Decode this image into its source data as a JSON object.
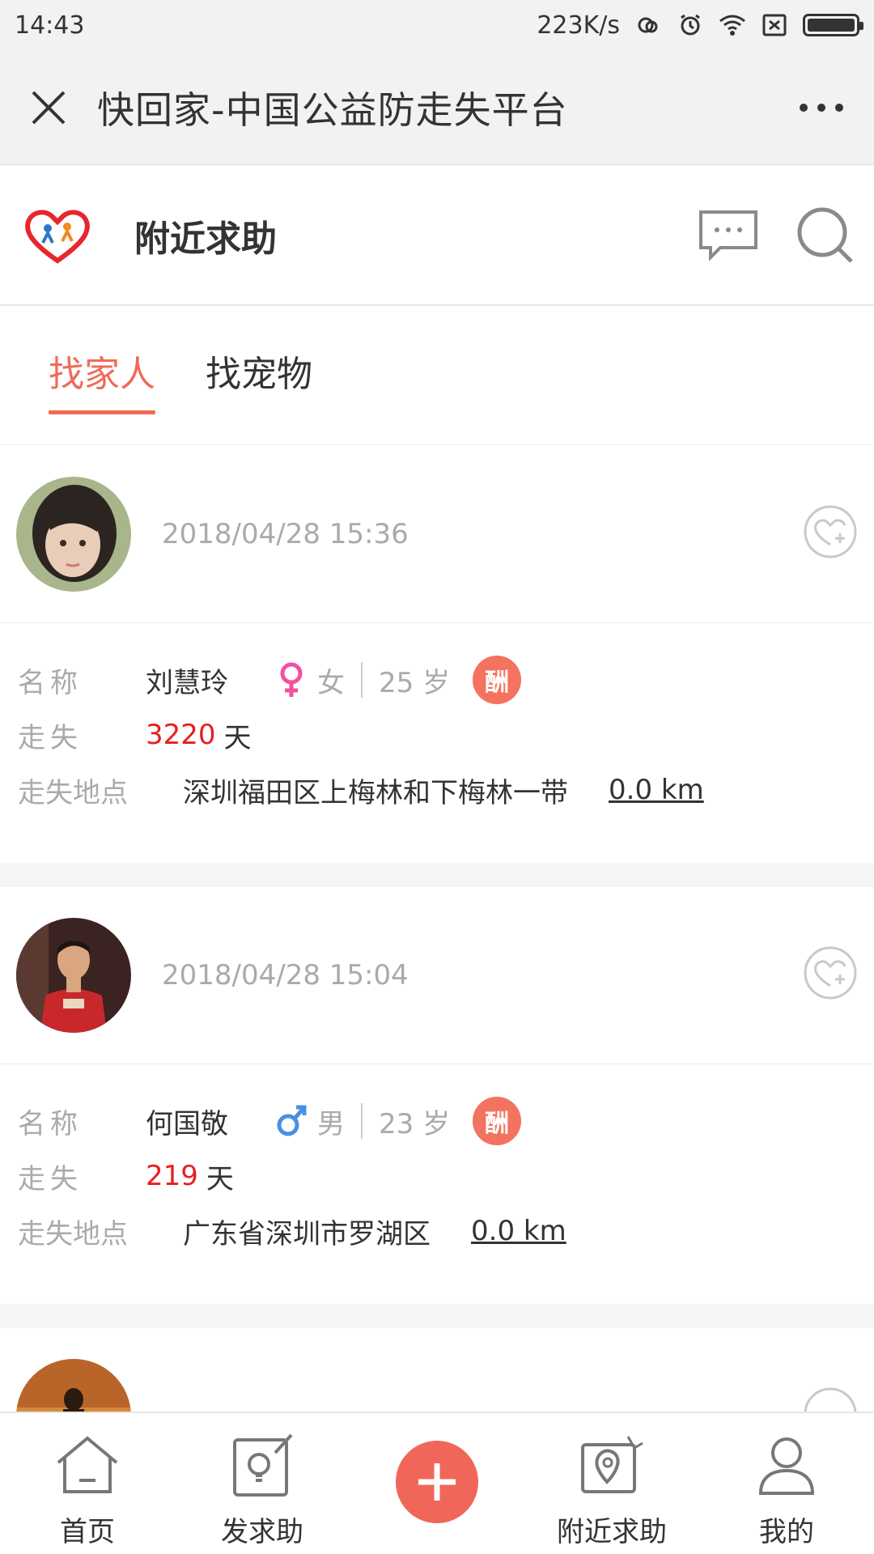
{
  "status_bar": {
    "time": "14:43",
    "speed": "223K/s"
  },
  "title_bar": {
    "title": "快回家-中国公益防走失平台"
  },
  "header": {
    "title": "附近求助"
  },
  "tabs": [
    {
      "label": "找家人",
      "active": true
    },
    {
      "label": "找宠物",
      "active": false
    }
  ],
  "cards": [
    {
      "date": "2018/04/28 15:36",
      "name_label": "名称",
      "name": "刘慧玲",
      "gender": "女",
      "age": "25 岁",
      "reward_badge": "酬",
      "missing_label": "走失",
      "missing_days": "3220",
      "days_unit": "天",
      "place_label": "走失地点",
      "place": "深圳福田区上梅林和下梅林一带",
      "distance": "0.0 km"
    },
    {
      "date": "2018/04/28 15:04",
      "name_label": "名称",
      "name": "何国敬",
      "gender": "男",
      "age": "23 岁",
      "reward_badge": "酬",
      "missing_label": "走失",
      "missing_days": "219",
      "days_unit": "天",
      "place_label": "走失地点",
      "place": "广东省深圳市罗湖区",
      "distance": "0.0 km"
    }
  ],
  "bottom_nav": [
    {
      "label": "首页",
      "icon": "home-icon"
    },
    {
      "label": "发求助",
      "icon": "post-help-icon"
    },
    {
      "label": "",
      "icon": "plus-icon"
    },
    {
      "label": "附近求助",
      "icon": "nearby-map-icon"
    },
    {
      "label": "我的",
      "icon": "profile-icon"
    }
  ],
  "colors": {
    "accent": "#f06a5a",
    "days": "#e61f1f",
    "female": "#f44fa0",
    "male": "#4a90e2"
  }
}
